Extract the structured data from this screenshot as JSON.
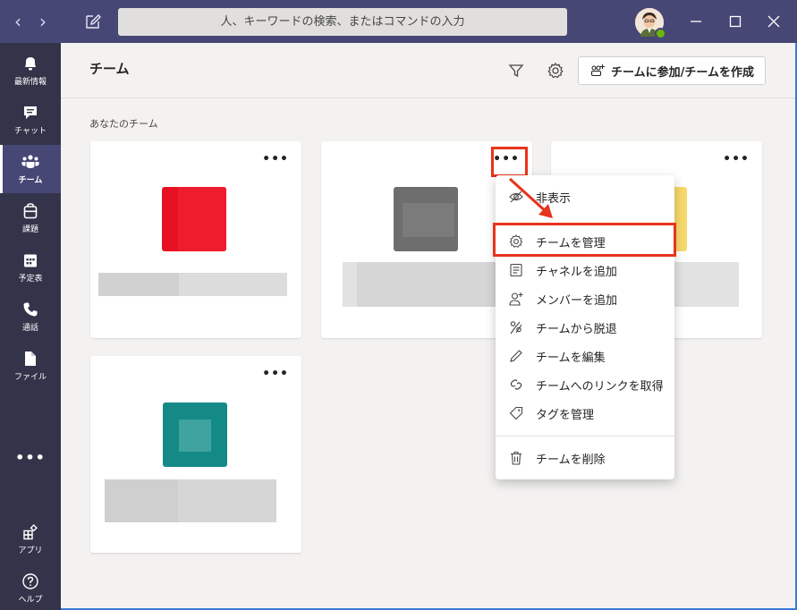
{
  "titlebar": {
    "back_icon": "chevron-left-icon",
    "forward_icon": "chevron-right-icon",
    "search_placeholder": "人、キーワードの検索、またはコマンドの入力"
  },
  "rail": {
    "items": [
      {
        "label": "最新情報",
        "icon": "bell-icon"
      },
      {
        "label": "チャット",
        "icon": "chat-icon"
      },
      {
        "label": "チーム",
        "icon": "teams-icon",
        "active": true
      },
      {
        "label": "課題",
        "icon": "assignments-icon"
      },
      {
        "label": "予定表",
        "icon": "calendar-icon"
      },
      {
        "label": "通話",
        "icon": "phone-icon"
      },
      {
        "label": "ファイル",
        "icon": "file-icon"
      }
    ],
    "more": "•••",
    "bottom": [
      {
        "label": "アプリ",
        "icon": "apps-icon"
      },
      {
        "label": "ヘルプ",
        "icon": "help-icon"
      }
    ]
  },
  "main": {
    "title": "チーム",
    "join_button": "チームに参加/チームを作成",
    "section_label": "あなたのチーム",
    "more_glyph": "•••"
  },
  "teams": [
    {
      "color": "#e81123"
    },
    {
      "color": "#6e6e6e"
    },
    {
      "color": "#f7d96b"
    },
    {
      "color": "#148a87"
    }
  ],
  "menu": {
    "items": [
      {
        "label": "非表示",
        "icon": "hide-icon"
      },
      {
        "label": "チームを管理",
        "icon": "gear-icon"
      },
      {
        "label": "チャネルを追加",
        "icon": "add-channel-icon"
      },
      {
        "label": "メンバーを追加",
        "icon": "add-member-icon"
      },
      {
        "label": "チームから脱退",
        "icon": "leave-icon"
      },
      {
        "label": "チームを編集",
        "icon": "pencil-icon"
      },
      {
        "label": "チームへのリンクを取得",
        "icon": "link-icon"
      },
      {
        "label": "タグを管理",
        "icon": "tag-icon"
      },
      {
        "label": "チームを削除",
        "icon": "trash-icon"
      }
    ]
  },
  "colors": {
    "titlebar": "#464775",
    "rail": "#33344a",
    "highlight": "#e8331c"
  }
}
